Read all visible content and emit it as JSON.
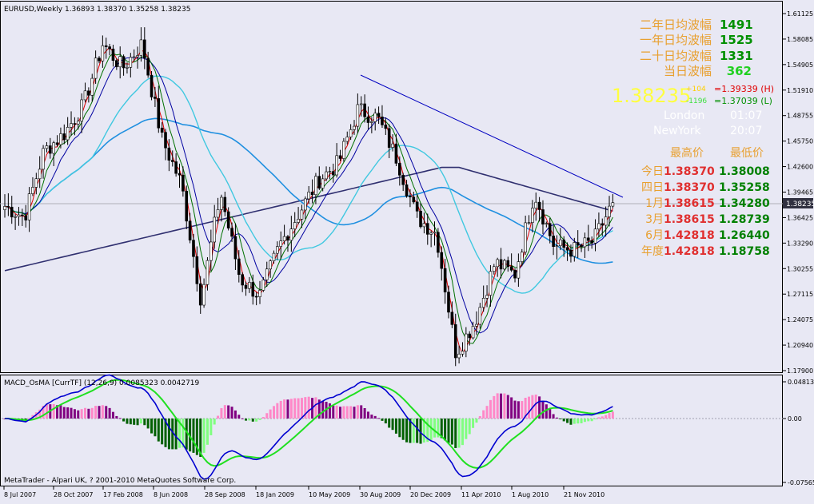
{
  "main_chart": {
    "header": "EURUSD,Weekly  1.36893 1.38370 1.35258 1.38235",
    "price_labels": [
      "1.61125",
      "1.58085",
      "1.54905",
      "1.51910",
      "1.48755",
      "1.45750",
      "1.42600",
      "1.39465",
      "1.36425",
      "1.33290",
      "1.30255",
      "1.27115",
      "1.24075",
      "1.20940",
      "1.17900"
    ],
    "current_price_tag": "1.38235",
    "trendline_note": "descending resistance line"
  },
  "macd": {
    "title": "MACD_OsMA [CurrTF] (12,26,9) 0.0085323 0.0042719",
    "scale_labels": [
      "0.048133",
      "0.00",
      "-0.075651"
    ],
    "copyright": "MetaTrader - Alpari UK, ? 2001-2010 MetaQuotes Software Corp."
  },
  "xaxis_labels": [
    "8 Jul 2007",
    "28 Oct 2007",
    "17 Feb 2008",
    "8 Jun 2008",
    "28 Sep 2008",
    "18 Jan 2009",
    "10 May 2009",
    "30 Aug 2009",
    "20 Dec 2009",
    "11 Apr 2010",
    "1 Aug 2010",
    "21 Nov 2010"
  ],
  "info_panel": {
    "volatility": [
      {
        "label": "二年日均波幅",
        "value": "1491"
      },
      {
        "label": "一年日均波幅",
        "value": "1525"
      },
      {
        "label": "二十日均波幅",
        "value": "1331"
      },
      {
        "label": "当日波幅",
        "value": "362"
      }
    ],
    "big_price": "1.38235",
    "small_up": "+104",
    "small_down": "-1196",
    "high_text": "=1.39339 (H)",
    "low_text": "=1.37039 (L)",
    "sessions": [
      {
        "city": "London",
        "time": "01:07"
      },
      {
        "city": "NewYork",
        "time": "20:07"
      }
    ],
    "header_high": "最高价",
    "header_low": "最低价",
    "ranges": [
      {
        "label": "今日",
        "high": "1.38370",
        "low": "1.38008"
      },
      {
        "label": "四日",
        "high": "1.38370",
        "low": "1.35258"
      },
      {
        "label": "1月",
        "high": "1.38615",
        "low": "1.34280"
      },
      {
        "label": "3月",
        "high": "1.38615",
        "low": "1.28739"
      },
      {
        "label": "6月",
        "high": "1.42818",
        "low": "1.26440"
      },
      {
        "label": "年度",
        "high": "1.42818",
        "low": "1.18758"
      }
    ]
  },
  "colors": {
    "background": "#E8E8F4",
    "up_candle": "#FFFFFF",
    "down_candle": "#000000",
    "ma_fast": "#E00000",
    "ma_mid": "#007000",
    "ma_slow": "#0000A0",
    "ma_cyan": "#40C8E0",
    "ma_blue": "#2090E0",
    "ma_long": "#303070",
    "osma_pos_bright": "#FF88C8",
    "osma_pos_dark": "#800080",
    "osma_neg_bright": "#80FF80",
    "osma_neg_dark": "#006000",
    "macd_line": "#0000D0",
    "signal_line": "#20E020",
    "trendline": "#0000C0"
  },
  "chart_data": [
    {
      "type": "candlestick",
      "title": "EURUSD,Weekly",
      "ylim": [
        1.179,
        1.6113
      ],
      "x_tick_labels": [
        "8 Jul 2007",
        "28 Oct 2007",
        "17 Feb 2008",
        "8 Jun 2008",
        "28 Sep 2008",
        "18 Jan 2009",
        "10 May 2009",
        "30 Aug 2009",
        "20 Dec 2009",
        "11 Apr 2010",
        "1 Aug 2010",
        "21 Nov 2010"
      ],
      "close_path": [
        [
          "8 Jul 2007",
          1.378
        ],
        [
          "2 Sep 2007",
          1.365
        ],
        [
          "28 Oct 2007",
          1.445
        ],
        [
          "23 Dec 2007",
          1.465
        ],
        [
          "17 Feb 2008",
          1.5
        ],
        [
          "13 Apr 2008",
          1.575
        ],
        [
          "8 Jun 2008",
          1.545
        ],
        [
          "27 Jul 2008",
          1.575
        ],
        [
          "31 Aug 2008",
          1.46
        ],
        [
          "28 Sep 2008",
          1.405
        ],
        [
          "9 Nov 2008",
          1.265
        ],
        [
          "14 Dec 2008",
          1.395
        ],
        [
          "18 Jan 2009",
          1.29
        ],
        [
          "1 Mar 2009",
          1.27
        ],
        [
          "29 Mar 2009",
          1.33
        ],
        [
          "10 May 2009",
          1.37
        ],
        [
          "21 Jun 2009",
          1.41
        ],
        [
          "30 Aug 2009",
          1.43
        ],
        [
          "18 Oct 2009",
          1.495
        ],
        [
          "15 Nov 2009",
          1.485
        ],
        [
          "20 Dec 2009",
          1.435
        ],
        [
          "7 Feb 2010",
          1.365
        ],
        [
          "11 Apr 2010",
          1.345
        ],
        [
          "6 Jun 2010",
          1.2
        ],
        [
          "27 Jun 2010",
          1.24
        ],
        [
          "1 Aug 2010",
          1.31
        ],
        [
          "5 Sep 2010",
          1.295
        ],
        [
          "10 Oct 2010",
          1.395
        ],
        [
          "21 Nov 2010",
          1.33
        ],
        [
          "5 Dec 2010",
          1.325
        ],
        [
          "19 Dec 2010",
          1.335
        ],
        [
          "2 Jan 2011",
          1.382
        ]
      ],
      "trendline": [
        [
          "30 Aug 2009",
          1.555
        ],
        [
          "2 Jan 2011",
          1.395
        ]
      ]
    },
    {
      "type": "bar",
      "title": "MACD_OsMA [CurrTF] (12,26,9) 0.0085323 0.0042719",
      "ylim": [
        -0.075651,
        0.048133
      ],
      "macd_value": 0.0085323,
      "signal_value": 0.0042719
    }
  ]
}
